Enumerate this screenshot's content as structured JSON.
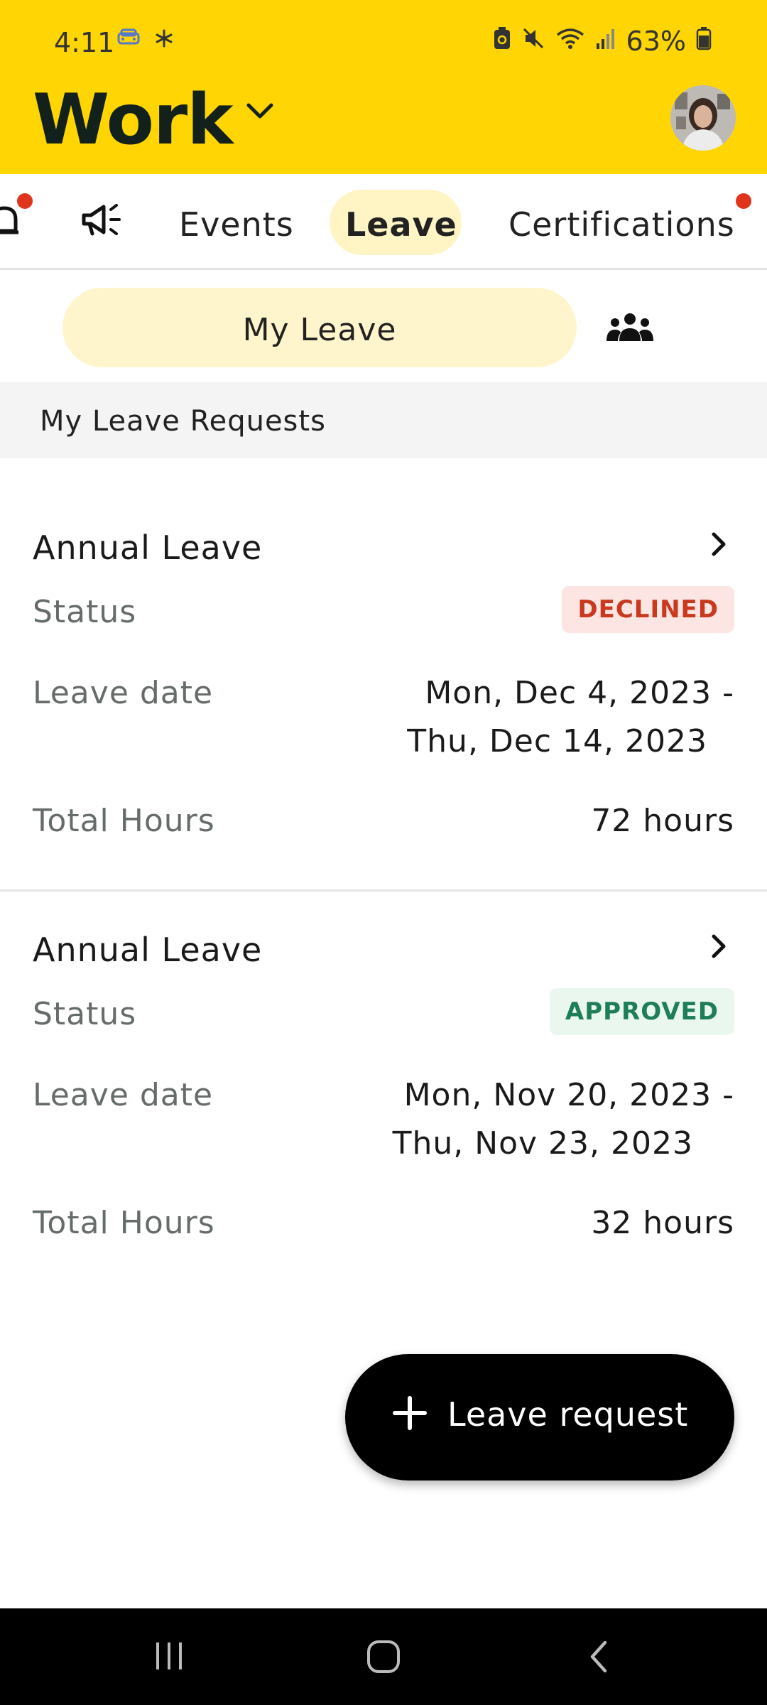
{
  "status_bar": {
    "time": "4:11",
    "battery": "63%",
    "icons": [
      "car-icon",
      "asterisk-icon",
      "battery-saver-icon",
      "mute-icon",
      "wifi-icon",
      "signal-icon",
      "battery-icon"
    ]
  },
  "header": {
    "title": "Work",
    "background_color": "#FFD503"
  },
  "tabs": [
    {
      "label": "",
      "icon": "bell-icon",
      "has_dot": true
    },
    {
      "label": "",
      "icon": "megaphone-icon",
      "has_dot": false
    },
    {
      "label": "Events",
      "has_dot": false
    },
    {
      "label": "Leave",
      "selected": true,
      "has_dot": false
    },
    {
      "label": "Certifications",
      "has_dot": true
    }
  ],
  "segment": {
    "selected_label": "My Leave",
    "other_icon": "team-icon"
  },
  "section": {
    "title": "My Leave Requests"
  },
  "requests": [
    {
      "type": "Annual Leave",
      "status_label": "Status",
      "status": "DECLINED",
      "date_label": "Leave date",
      "date_line1": "Mon, Dec 4, 2023 -",
      "date_line2": "Thu, Dec 14, 2023",
      "hours_label": "Total Hours",
      "hours": "72 hours"
    },
    {
      "type": "Annual Leave",
      "status_label": "Status",
      "status": "APPROVED",
      "date_label": "Leave date",
      "date_line1": "Mon, Nov 20, 2023 -",
      "date_line2": "Thu, Nov 23, 2023",
      "hours_label": "Total Hours",
      "hours": "32 hours"
    }
  ],
  "fab": {
    "label": "Leave request"
  },
  "colors": {
    "accent": "#FFD503",
    "declined_text": "#C9391D",
    "approved_text": "#1E7E58",
    "notification_dot": "#E0341D"
  }
}
